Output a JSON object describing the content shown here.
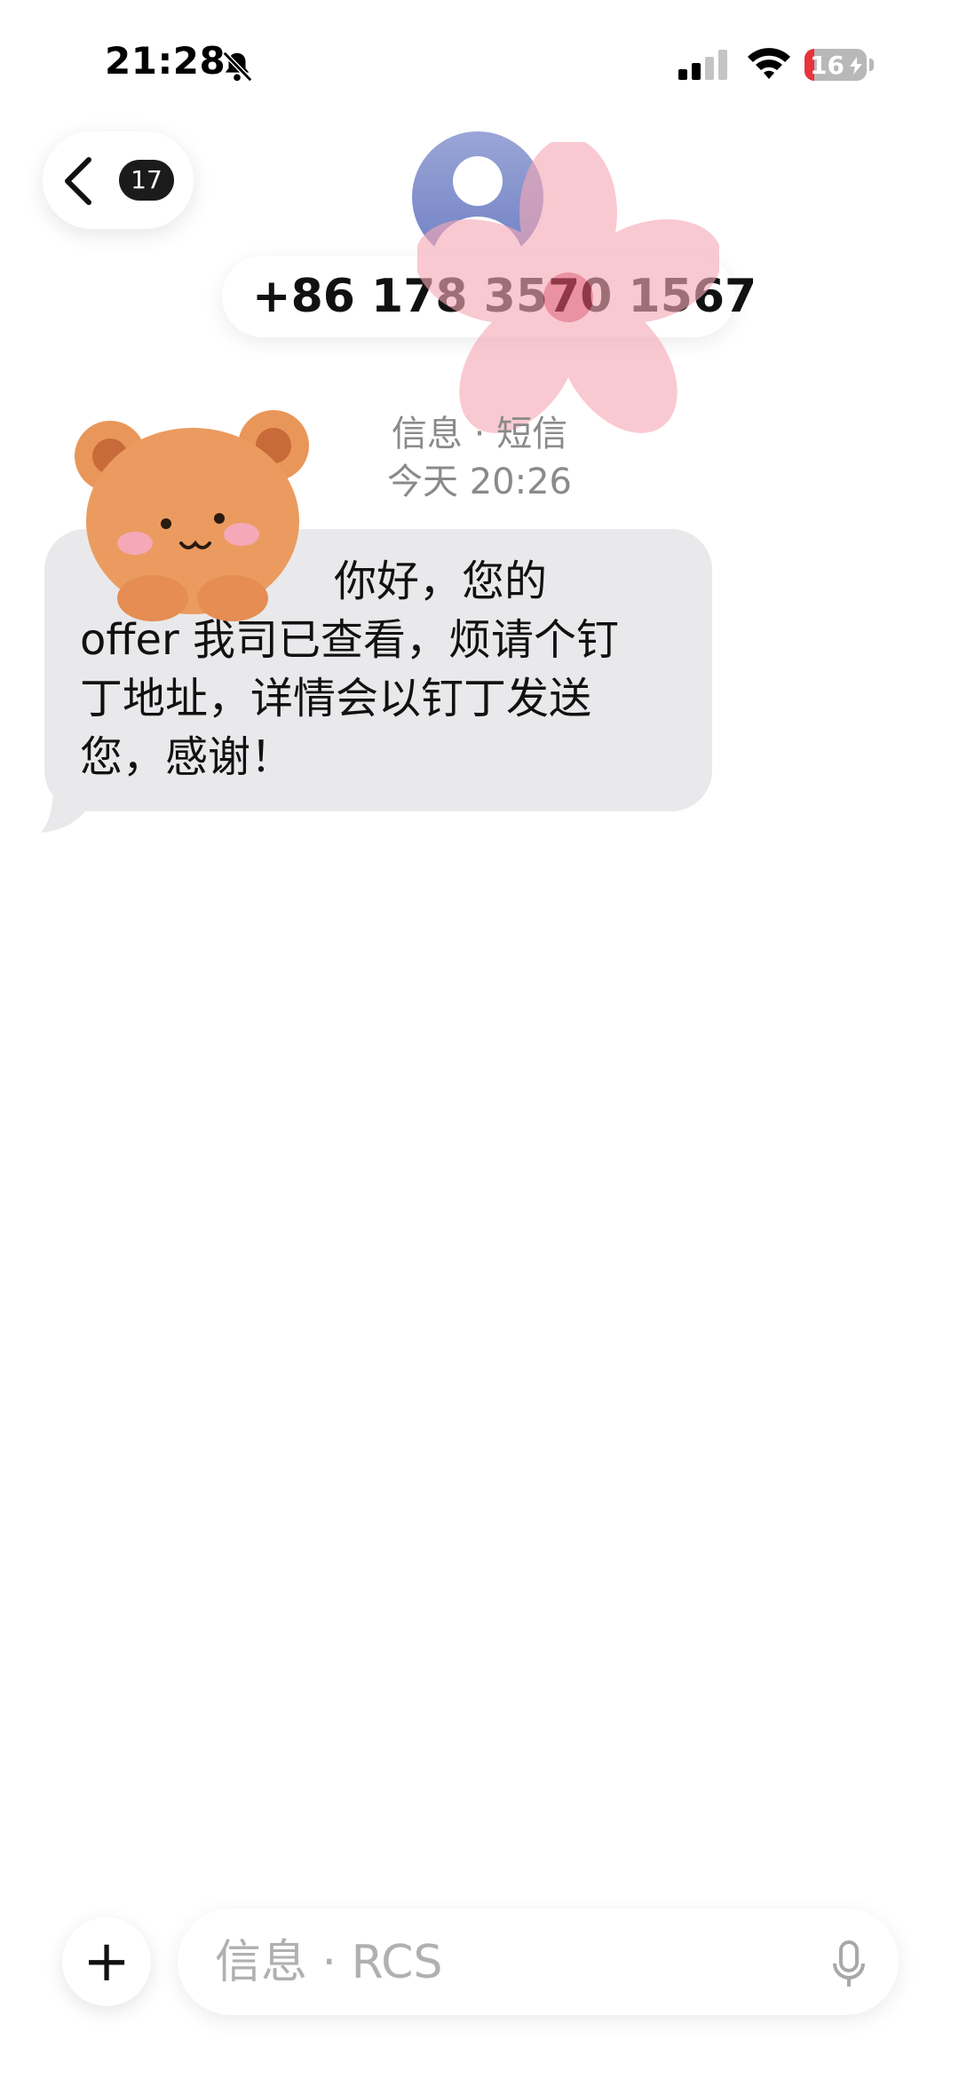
{
  "status_bar": {
    "time": "21:28",
    "battery_level": "16",
    "battery_fraction": 0.16,
    "icons": [
      "bell-slash-icon",
      "signal-icon",
      "wifi-icon",
      "battery-icon",
      "bolt-icon"
    ]
  },
  "header": {
    "back_badge_count": "17",
    "contact_number": "+86 178 3570 1567",
    "icons": [
      "chevron-left-icon",
      "contact-avatar-icon"
    ]
  },
  "thread": {
    "service_label": "信息 · 短信",
    "timestamp": "今天 20:26",
    "message_lines": [
      "你好，您的",
      "offer 我司已查看，烦请个钉",
      "丁地址，详情会以钉丁发送",
      "您，感谢！"
    ],
    "bubble_color": "#e9e9eb"
  },
  "stickers": [
    "bear-sticker",
    "flower-sticker"
  ],
  "compose": {
    "placeholder": "信息 · RCS",
    "icons": [
      "plus-icon",
      "microphone-icon"
    ]
  },
  "colors": {
    "battery_low": "#e8323c",
    "avatar": "#7e8dcc",
    "text": "#111111",
    "meta_text": "#8a8a8a"
  }
}
